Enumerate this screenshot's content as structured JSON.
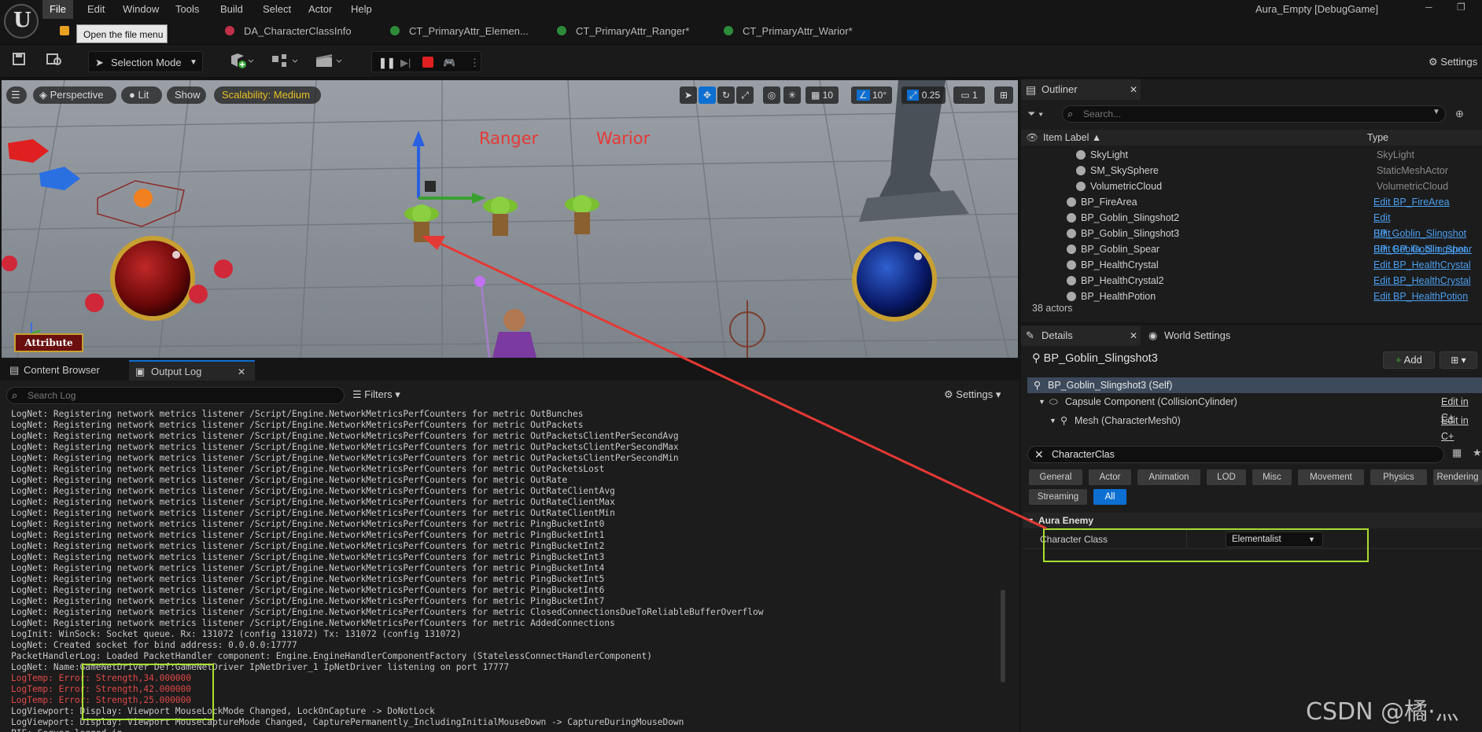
{
  "menu": {
    "items": [
      "File",
      "Edit",
      "Window",
      "Tools",
      "Build",
      "Select",
      "Actor",
      "Help"
    ],
    "project_title": "Aura_Empty [DebugGame]",
    "tooltip": "Open the file menu"
  },
  "tabs": [
    {
      "label": "DA_CharacterClassInfo",
      "color": "#c0304a"
    },
    {
      "label": "CT_PrimaryAttr_Elemen...",
      "color": "#2e8b3a"
    },
    {
      "label": "CT_PrimaryAttr_Ranger*",
      "color": "#2e8b3a"
    },
    {
      "label": "CT_PrimaryAttr_Warior*",
      "color": "#2e8b3a"
    }
  ],
  "toolbar": {
    "selection_mode": "Selection Mode",
    "settings": "Settings"
  },
  "viewport": {
    "perspective": "Perspective",
    "lit": "Lit",
    "show": "Show",
    "scalability": "Scalability: Medium",
    "grid_value": "10",
    "rotation_value": "10°",
    "scale_value": "0.25",
    "camera_speed": "1",
    "label_ranger": "Ranger",
    "label_warior": "Warior",
    "attribute_button": "Attribute"
  },
  "outliner": {
    "tab": "Outliner",
    "search_placeholder": "Search...",
    "col_label": "Item Label ▲",
    "col_type": "Type",
    "rows": [
      {
        "label": "SkyLight",
        "type": "SkyLight",
        "link": false,
        "indent": 1
      },
      {
        "label": "SM_SkySphere",
        "type": "StaticMeshActor",
        "link": false,
        "indent": 1
      },
      {
        "label": "VolumetricCloud",
        "type": "VolumetricCloud",
        "link": false,
        "indent": 1
      },
      {
        "label": "BP_FireArea",
        "type": "Edit BP_FireArea",
        "link": true,
        "indent": 0
      },
      {
        "label": "BP_Goblin_Slingshot2",
        "type": "Edit BP_Goblin_Slingshot",
        "link": true,
        "indent": 0
      },
      {
        "label": "BP_Goblin_Slingshot3",
        "type": "Edit BP_Goblin_Slingshot",
        "link": true,
        "indent": 0
      },
      {
        "label": "BP_Goblin_Spear",
        "type": "Edit BP_Goblin_Spear",
        "link": true,
        "indent": 0
      },
      {
        "label": "BP_HealthCrystal",
        "type": "Edit BP_HealthCrystal",
        "link": true,
        "indent": 0
      },
      {
        "label": "BP_HealthCrystal2",
        "type": "Edit BP_HealthCrystal",
        "link": true,
        "indent": 0
      },
      {
        "label": "BP_HealthPotion",
        "type": "Edit BP_HealthPotion",
        "link": true,
        "indent": 0
      }
    ],
    "actor_count": "38 actors"
  },
  "details": {
    "tab": "Details",
    "tab2": "World Settings",
    "object_name": "BP_Goblin_Slingshot3",
    "add_label": "Add",
    "components": [
      {
        "label": "BP_Goblin_Slingshot3 (Self)",
        "right": ""
      },
      {
        "label": "Capsule Component (CollisionCylinder)",
        "right": "Edit in C+"
      },
      {
        "label": "Mesh (CharacterMesh0)",
        "right": "Edit in C+"
      }
    ],
    "search_value": "CharacterClas",
    "filters": [
      "General",
      "Actor",
      "Animation",
      "LOD",
      "Misc",
      "Movement",
      "Physics",
      "Rendering",
      "Streaming",
      "All"
    ],
    "section": "Aura Enemy",
    "property_label": "Character Class",
    "property_value": "Elementalist"
  },
  "bottom": {
    "tab_content": "Content Browser",
    "tab_output": "Output Log",
    "search_placeholder": "Search Log",
    "filters": "Filters",
    "settings": "Settings",
    "log_lines": [
      "LogNet: Registering network metrics listener /Script/Engine.NetworkMetricsPerfCounters for metric OutBunches",
      "LogNet: Registering network metrics listener /Script/Engine.NetworkMetricsPerfCounters for metric OutPackets",
      "LogNet: Registering network metrics listener /Script/Engine.NetworkMetricsPerfCounters for metric OutPacketsClientPerSecondAvg",
      "LogNet: Registering network metrics listener /Script/Engine.NetworkMetricsPerfCounters for metric OutPacketsClientPerSecondMax",
      "LogNet: Registering network metrics listener /Script/Engine.NetworkMetricsPerfCounters for metric OutPacketsClientPerSecondMin",
      "LogNet: Registering network metrics listener /Script/Engine.NetworkMetricsPerfCounters for metric OutPacketsLost",
      "LogNet: Registering network metrics listener /Script/Engine.NetworkMetricsPerfCounters for metric OutRate",
      "LogNet: Registering network metrics listener /Script/Engine.NetworkMetricsPerfCounters for metric OutRateClientAvg",
      "LogNet: Registering network metrics listener /Script/Engine.NetworkMetricsPerfCounters for metric OutRateClientMax",
      "LogNet: Registering network metrics listener /Script/Engine.NetworkMetricsPerfCounters for metric OutRateClientMin",
      "LogNet: Registering network metrics listener /Script/Engine.NetworkMetricsPerfCounters for metric PingBucketInt0",
      "LogNet: Registering network metrics listener /Script/Engine.NetworkMetricsPerfCounters for metric PingBucketInt1",
      "LogNet: Registering network metrics listener /Script/Engine.NetworkMetricsPerfCounters for metric PingBucketInt2",
      "LogNet: Registering network metrics listener /Script/Engine.NetworkMetricsPerfCounters for metric PingBucketInt3",
      "LogNet: Registering network metrics listener /Script/Engine.NetworkMetricsPerfCounters for metric PingBucketInt4",
      "LogNet: Registering network metrics listener /Script/Engine.NetworkMetricsPerfCounters for metric PingBucketInt5",
      "LogNet: Registering network metrics listener /Script/Engine.NetworkMetricsPerfCounters for metric PingBucketInt6",
      "LogNet: Registering network metrics listener /Script/Engine.NetworkMetricsPerfCounters for metric PingBucketInt7",
      "LogNet: Registering network metrics listener /Script/Engine.NetworkMetricsPerfCounters for metric ClosedConnectionsDueToReliableBufferOverflow",
      "LogNet: Registering network metrics listener /Script/Engine.NetworkMetricsPerfCounters for metric AddedConnections",
      "LogInit: WinSock: Socket queue. Rx: 131072 (config 131072) Tx: 131072 (config 131072)",
      "LogNet: Created socket for bind address: 0.0.0.0:17777",
      "PacketHandlerLog: Loaded PacketHandler component: Engine.EngineHandlerComponentFactory (StatelessConnectHandlerComponent)",
      "LogNet: Name:GameNetDriver Def:GameNetDriver IpNetDriver_1 IpNetDriver listening on port 17777",
      "LogTemp: Error: Strength,34.000000",
      "LogTemp: Error: Strength,42.000000",
      "LogTemp: Error: Strength,25.000000",
      "LogViewport: Display: Viewport MouseLockMode Changed, LockOnCapture -> DoNotLock",
      "LogViewport: Display: Viewport MouseCaptureMode Changed, CapturePermanently_IncludingInitialMouseDown -> CaptureDuringMouseDown",
      "PIE: Server logged in"
    ],
    "error_line_indexes": [
      24,
      25,
      26
    ]
  },
  "watermark": "CSDN @橘·灬",
  "colors": {
    "accent": "#0d6fd1",
    "annotation_green": "#a8e030",
    "annotation_red": "#e53935",
    "link": "#4a9ef0"
  }
}
